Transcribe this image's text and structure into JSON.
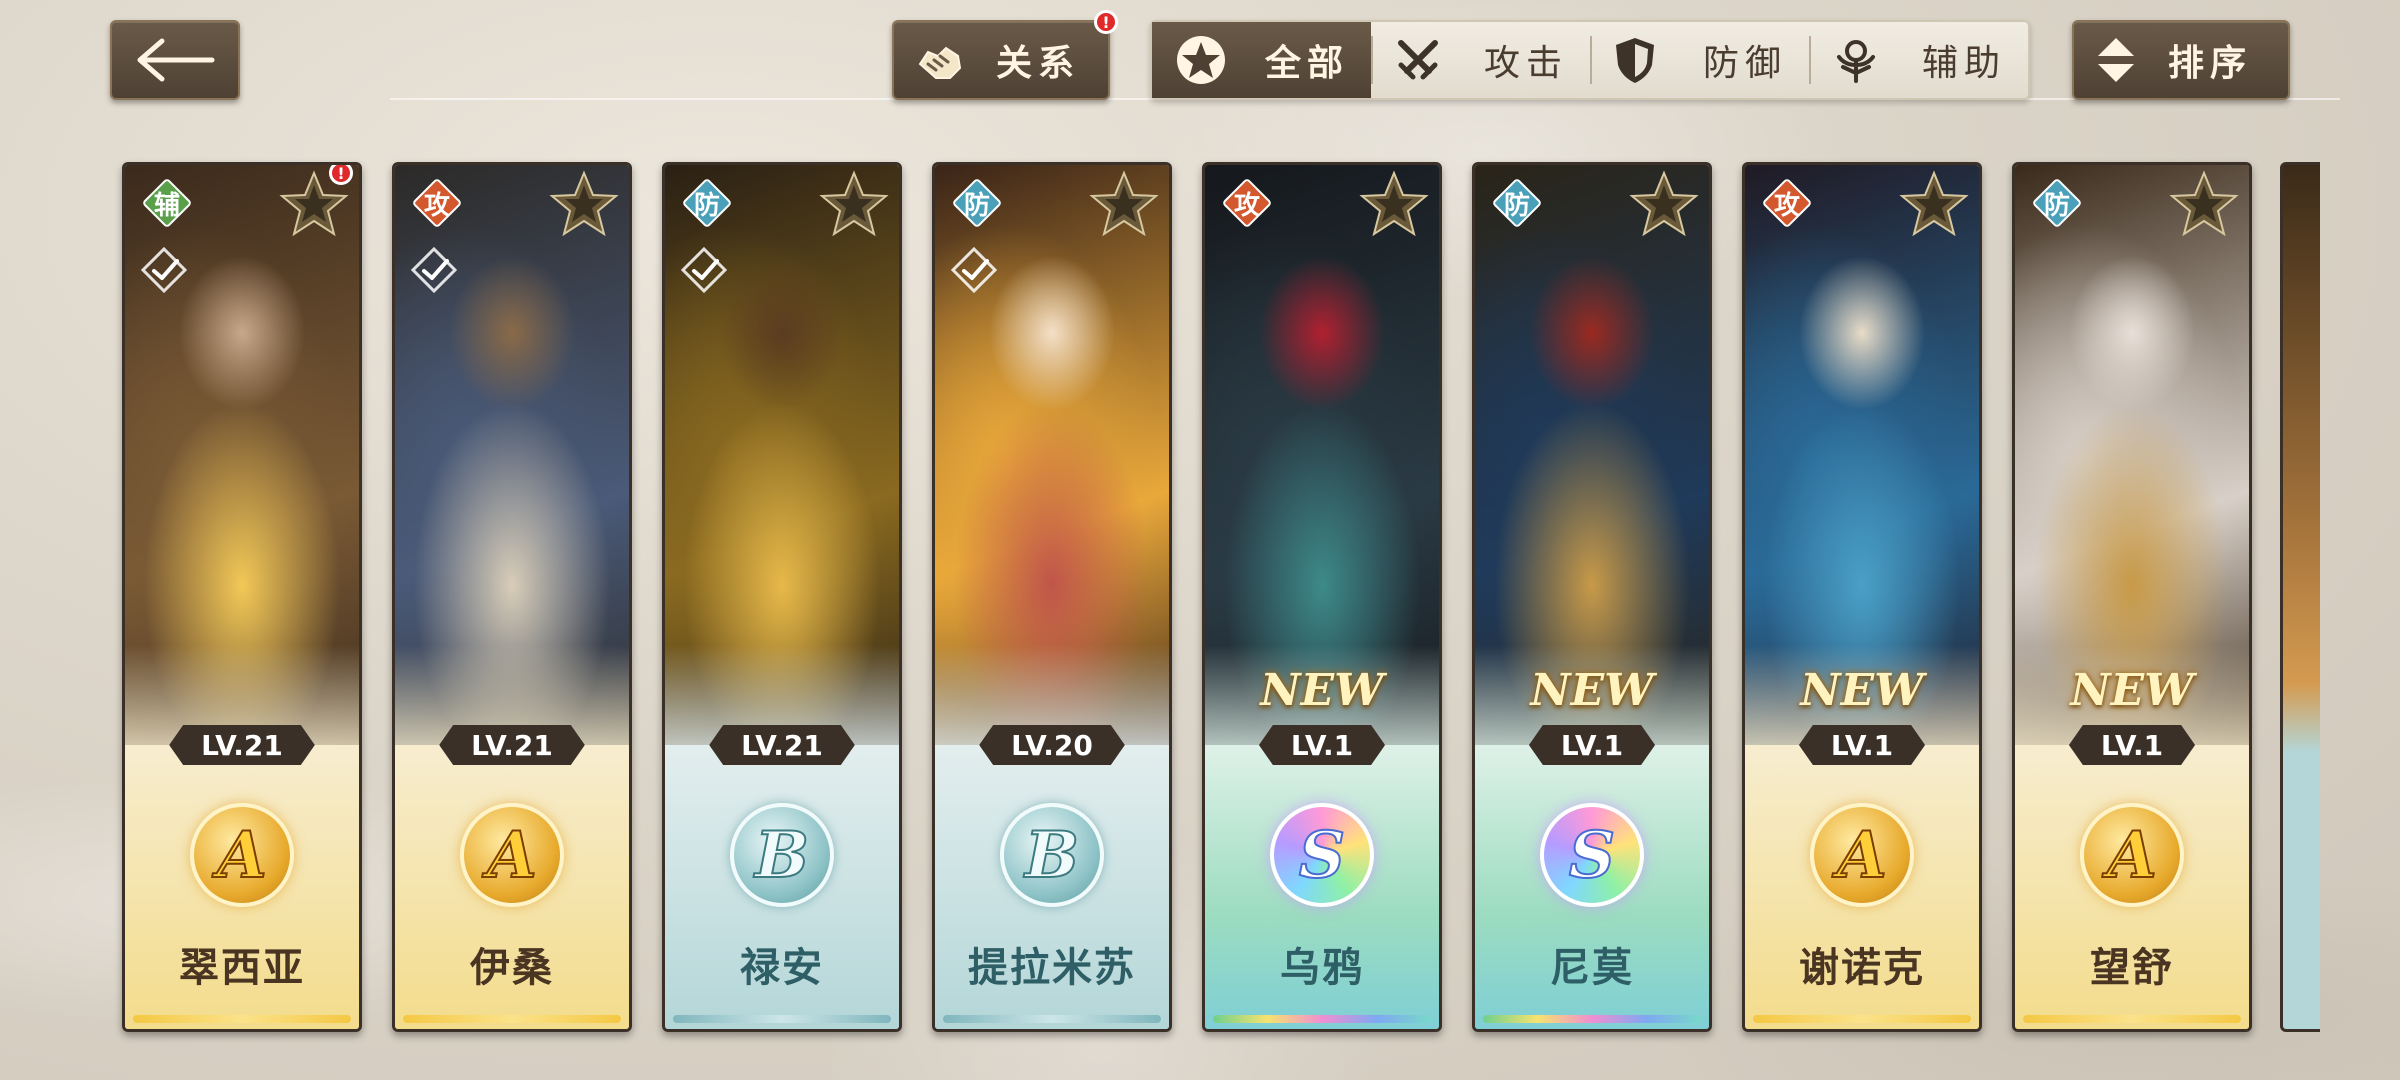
{
  "toolbar": {
    "relation_label": "关系",
    "relation_badge": "!",
    "sort_label": "排序"
  },
  "filters": [
    {
      "label": "全部",
      "icon": "star-emblem-icon",
      "active": true
    },
    {
      "label": "攻击",
      "icon": "crossed-swords-icon",
      "active": false
    },
    {
      "label": "防御",
      "icon": "shield-icon",
      "active": false
    },
    {
      "label": "辅助",
      "icon": "support-emblem-icon",
      "active": false
    }
  ],
  "cards": [
    {
      "name": "翠西亚",
      "role": "辅",
      "level": "LV.21",
      "grade": "A",
      "theme": "gold",
      "new": "",
      "badge": "!"
    },
    {
      "name": "伊桑",
      "role": "攻",
      "level": "LV.21",
      "grade": "A",
      "theme": "gold",
      "new": "",
      "badge": ""
    },
    {
      "name": "禄安",
      "role": "防",
      "level": "LV.21",
      "grade": "B",
      "theme": "blue",
      "new": "",
      "badge": ""
    },
    {
      "name": "提拉米苏",
      "role": "防",
      "level": "LV.20",
      "grade": "B",
      "theme": "blue",
      "new": "",
      "badge": ""
    },
    {
      "name": "乌鸦",
      "role": "攻",
      "level": "LV.1",
      "grade": "S",
      "theme": "rainbow",
      "new": "NEW",
      "badge": ""
    },
    {
      "name": "尼莫",
      "role": "防",
      "level": "LV.1",
      "grade": "S",
      "theme": "rainbow",
      "new": "NEW",
      "badge": ""
    },
    {
      "name": "谢诺克",
      "role": "攻",
      "level": "LV.1",
      "grade": "A",
      "theme": "gold",
      "new": "NEW",
      "badge": ""
    },
    {
      "name": "望舒",
      "role": "防",
      "level": "LV.1",
      "grade": "A",
      "theme": "gold",
      "new": "NEW",
      "badge": ""
    }
  ],
  "colors": {
    "role_support": "#5aa04a",
    "role_attack": "#d3582e",
    "role_defense": "#4aa0b8",
    "button_dark": "#4e4134",
    "badge_red": "#e02a2a"
  }
}
